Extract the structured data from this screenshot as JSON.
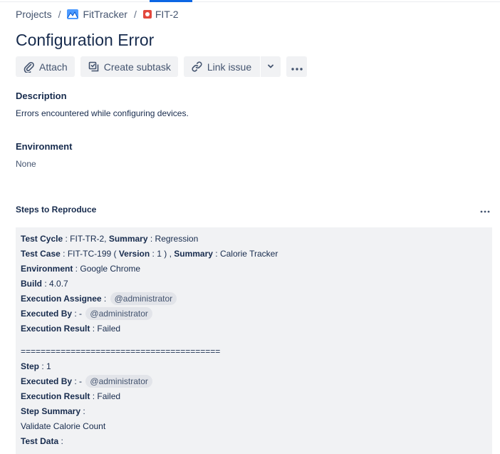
{
  "breadcrumb": {
    "root": "Projects",
    "project": "FitTracker",
    "issue_key": "FIT-2",
    "separator": "/"
  },
  "issue": {
    "title": "Configuration Error"
  },
  "toolbar": {
    "attach_label": "Attach",
    "create_subtask_label": "Create subtask",
    "link_issue_label": "Link issue"
  },
  "description": {
    "label": "Description",
    "text": "Errors encountered while configuring devices."
  },
  "environment": {
    "label": "Environment",
    "value": "None"
  },
  "steps": {
    "label": "Steps to Reproduce",
    "test_cycle_label": "Test Cycle",
    "test_cycle_value": "FIT-TR-2,",
    "summary_label": "Summary",
    "cycle_summary": "Regression",
    "test_case_label": "Test Case",
    "test_case_value": "FIT-TC-199",
    "version_label": "Version",
    "version_value": "1",
    "case_summary": "Calorie Tracker",
    "environment_label": "Environment",
    "environment_value": "Google Chrome",
    "build_label": "Build",
    "build_value": "4.0.7",
    "assignee_label": "Execution Assignee",
    "assignee_value": "@administrator",
    "executed_by_label": "Executed By",
    "executed_by_prefix": "-",
    "executed_by_value": "@administrator",
    "result_label": "Execution Result",
    "result_value": "Failed",
    "divider": "========================================",
    "step_label": "Step",
    "step_value": "1",
    "step_executed_by_label": "Executed By",
    "step_executed_by_prefix": "-",
    "step_executed_by_value": "@administrator",
    "step_result_label": "Execution Result",
    "step_result_value": "Failed",
    "step_summary_label": "Step Summary",
    "step_summary_value": "Validate Calorie Count",
    "test_data_label": "Test Data"
  },
  "colors": {
    "accent": "#0c66e4",
    "bug": "#e2483d",
    "button_bg": "#f1f2f4",
    "text": "#172b4d"
  },
  "icons": [
    "fittracker-project-icon",
    "bug-icon",
    "paperclip-icon",
    "subtask-icon",
    "link-icon",
    "chevron-down-icon",
    "more-icon"
  ]
}
